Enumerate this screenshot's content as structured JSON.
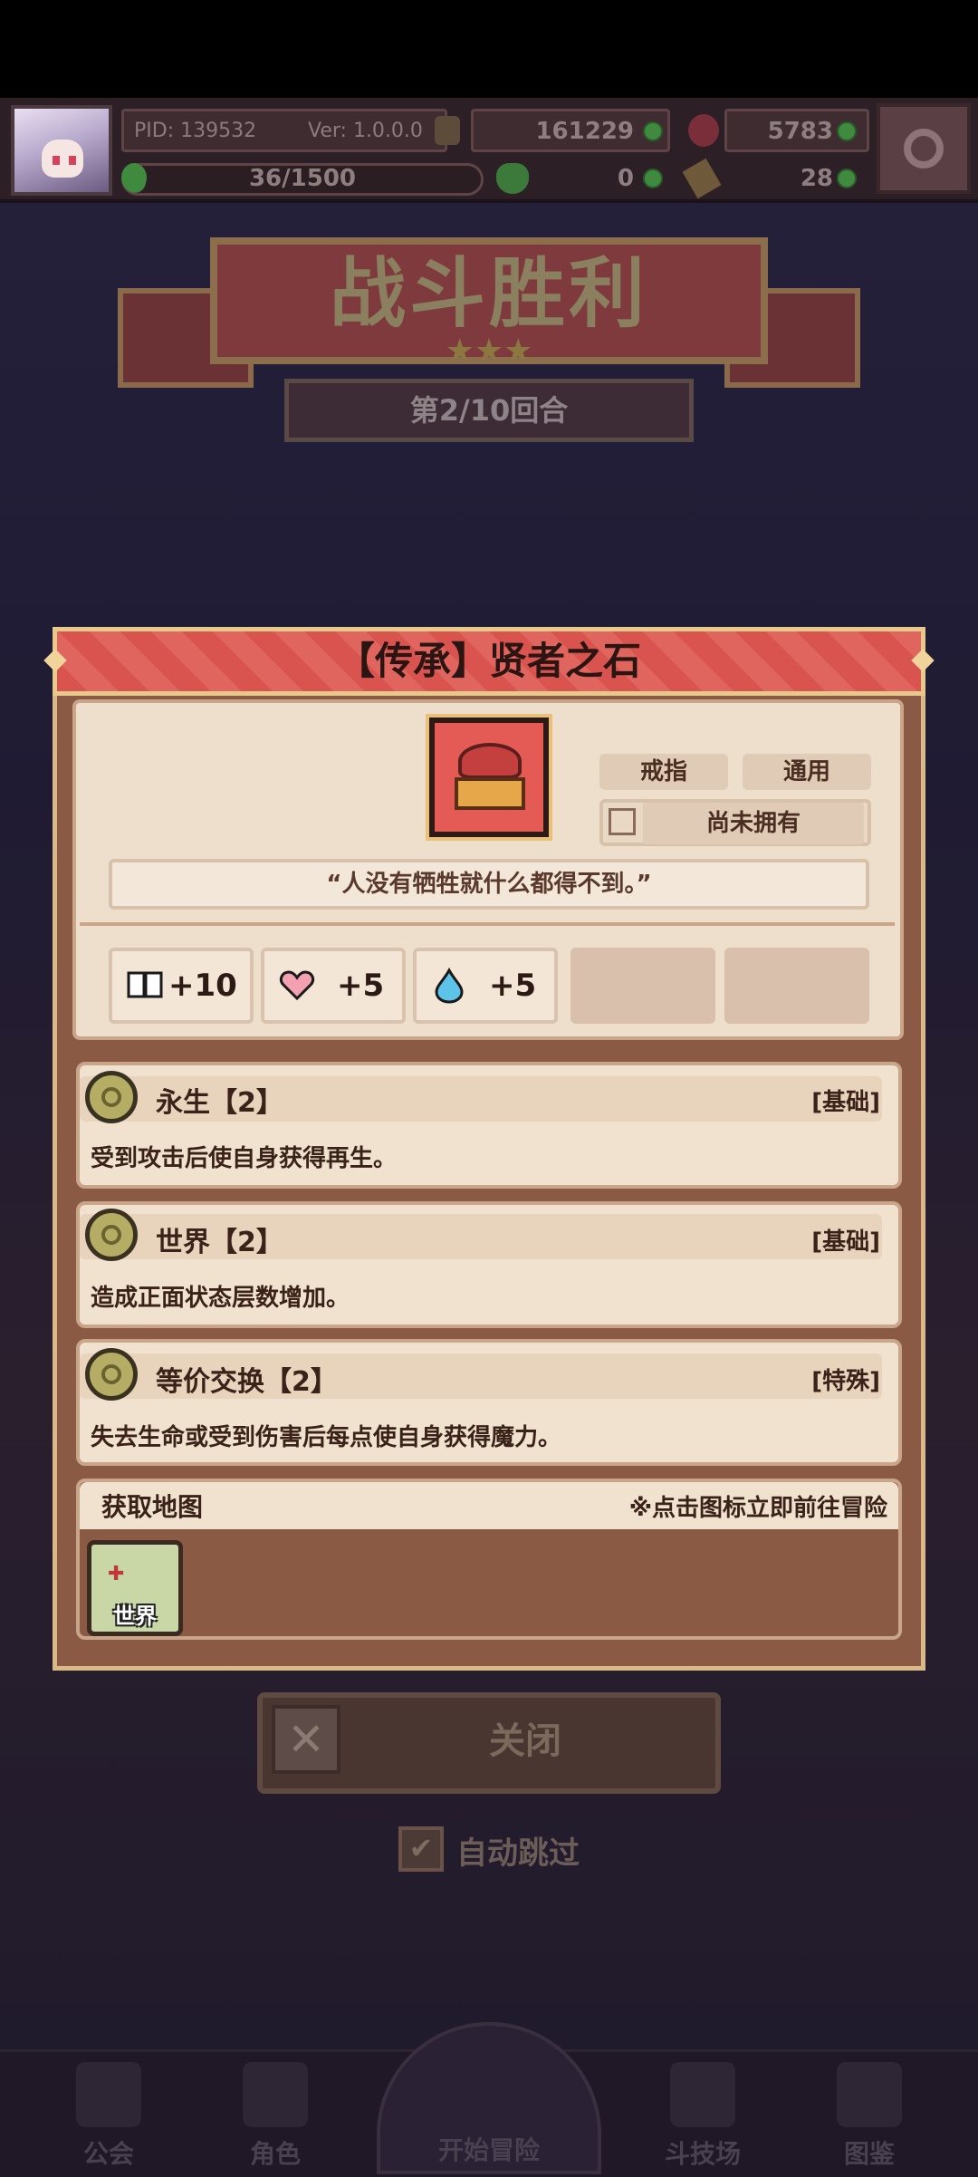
{
  "header": {
    "pid": "PID: 139532",
    "ver": "Ver: 1.0.0.0",
    "gold": "161229",
    "ruby": "5783",
    "stamina": "36/1500",
    "clover": "0",
    "leaf": "28",
    "stamina_fill": 0.024
  },
  "battle": {
    "title": "战斗胜利",
    "stars": "★★★",
    "round": "第2/10回合"
  },
  "dialog": {
    "title": "【传承】贤者之石",
    "tags": {
      "type": "戒指",
      "class": "通用",
      "ownership": "尚未拥有"
    },
    "quote": "“人没有牺牲就什么都得不到。”",
    "stats": [
      {
        "icon": "book-icon",
        "value": "+10"
      },
      {
        "icon": "heart-icon",
        "value": "+5"
      },
      {
        "icon": "water-drop-icon",
        "value": "+5"
      }
    ],
    "traits": [
      {
        "name": "永生【2】",
        "type": "[基础]",
        "desc": "受到攻击后使自身获得再生。"
      },
      {
        "name": "世界【2】",
        "type": "[基础]",
        "desc": "造成正面状态层数增加。"
      },
      {
        "name": "等价交换【2】",
        "type": "[特殊]",
        "desc": "失去生命或受到伤害后每点使自身获得魔力。"
      }
    ],
    "map": {
      "title": "获取地图",
      "hint": "※点击图标立即前往冒险",
      "world_label": "世界"
    }
  },
  "buttons": {
    "close_label": "关闭",
    "auto_skip_label": "自动跳过"
  },
  "nav": [
    {
      "label": "公会"
    },
    {
      "label": "角色"
    },
    {
      "label": "开始冒险"
    },
    {
      "label": "斗技场"
    },
    {
      "label": "图鉴"
    }
  ]
}
